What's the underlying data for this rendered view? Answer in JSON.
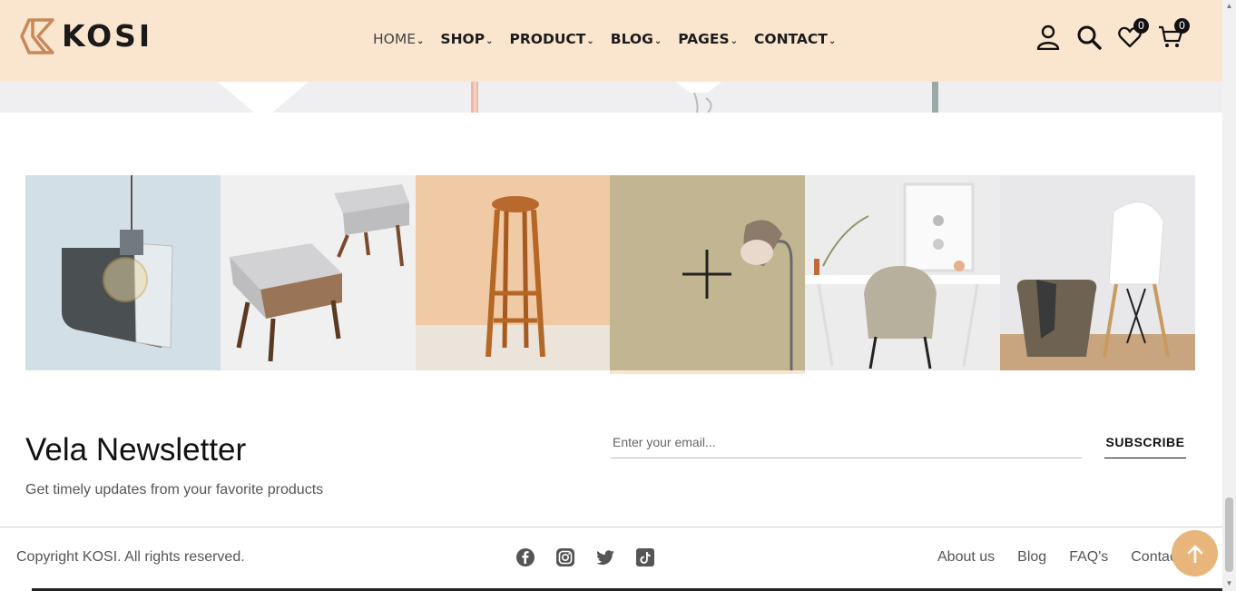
{
  "header": {
    "logo_text": "KOSI",
    "nav": [
      {
        "label": "HOME"
      },
      {
        "label": "SHOP"
      },
      {
        "label": "PRODUCT"
      },
      {
        "label": "BLOG"
      },
      {
        "label": "PAGES"
      },
      {
        "label": "CONTACT"
      }
    ],
    "wishlist_count": "0",
    "cart_count": "0",
    "background": "#fae6cf"
  },
  "gallery": {
    "tiles": [
      {
        "icon": "pendant-lamp"
      },
      {
        "icon": "side-tables"
      },
      {
        "icon": "bar-stool"
      },
      {
        "icon": "floor-lamp",
        "hovered": true
      },
      {
        "icon": "desk-chair"
      },
      {
        "icon": "white-chair-basket"
      }
    ]
  },
  "newsletter": {
    "title": "Vela Newsletter",
    "subtitle": "Get timely updates from your favorite products",
    "email_placeholder": "Enter your email...",
    "subscribe_label": "SUBSCRIBE"
  },
  "footer": {
    "copyright": "Copyright KOSI. All rights reserved.",
    "social": [
      "facebook-icon",
      "instagram-icon",
      "twitter-icon",
      "tiktok-icon"
    ],
    "links": [
      "About us",
      "Blog",
      "FAQ's",
      "Contact"
    ]
  },
  "colors": {
    "accent": "#e8b67a",
    "logo_accent": "#c8895a"
  }
}
